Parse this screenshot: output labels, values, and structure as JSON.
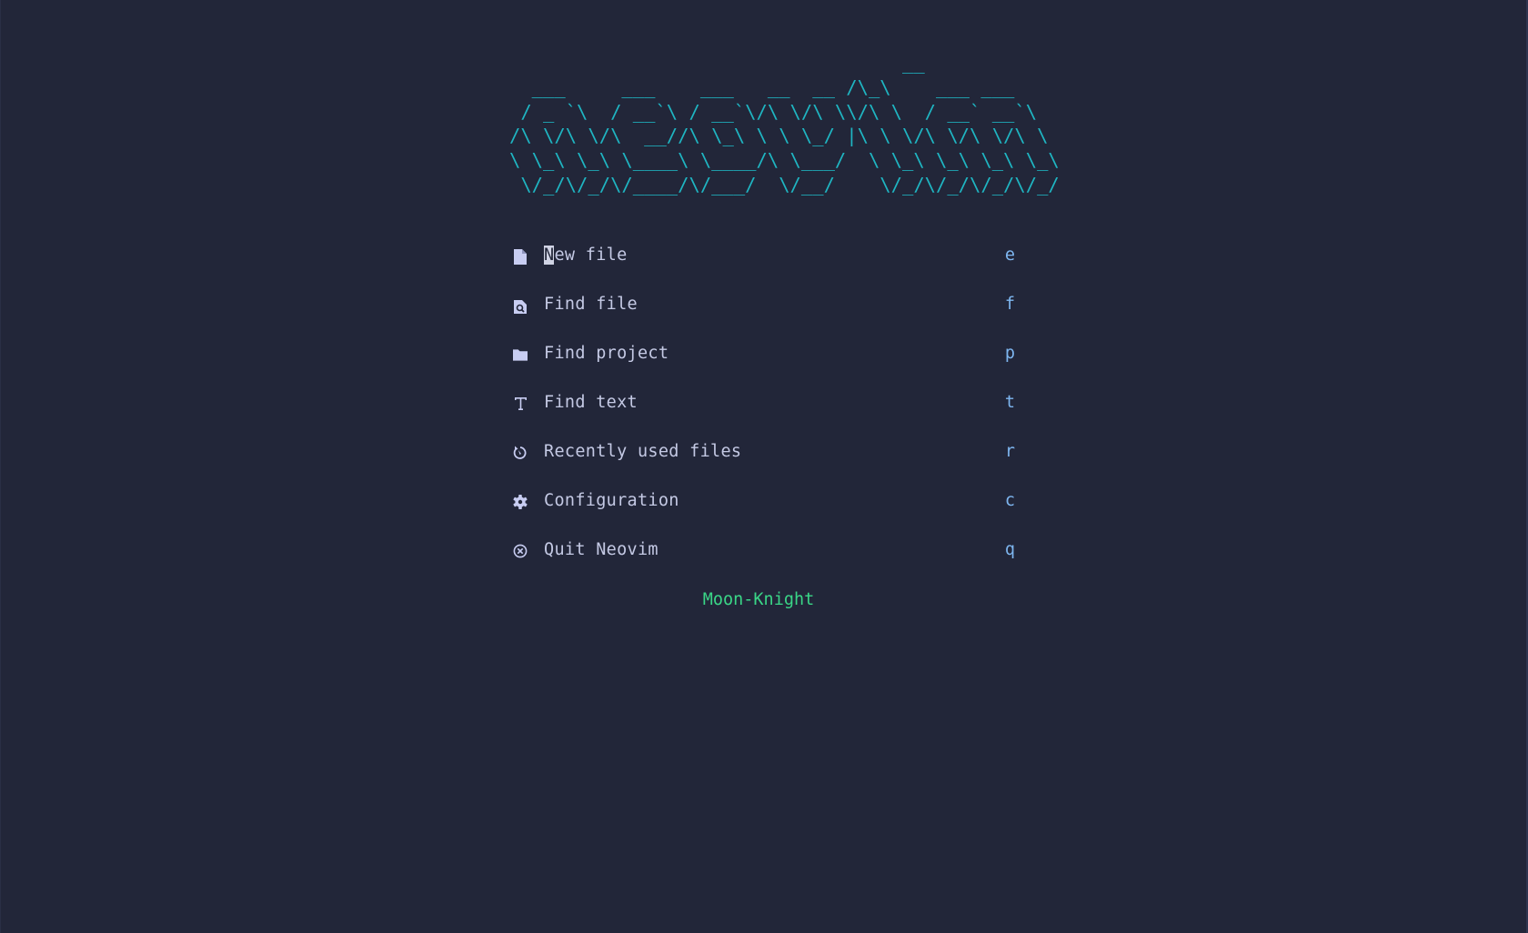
{
  "banner": {
    "ascii_art": "                                   __\n  ___     ___    ___   __  __ /\\_\\    ___ ___\n / _ `\\  / __`\\ / __`\\/\\ \\/\\ \\\\/\\ \\  / __` __`\\\n/\\ \\/\\ \\/\\  __//\\ \\_\\ \\ \\ \\_/ |\\ \\ \\/\\ \\/\\ \\/\\ \\\n\\ \\_\\ \\_\\ \\____\\ \\____/\\ \\___/  \\ \\_\\ \\_\\ \\_\\ \\_\\\n \\/_/\\/_/\\/____/\\/___/  \\/__/    \\/_/\\/_/\\/_/\\/_/",
    "color": "#1fb5c2"
  },
  "menu": {
    "items": [
      {
        "icon": "file-icon",
        "label_first": "N",
        "label_rest": "ew file",
        "key": "e"
      },
      {
        "icon": "file-search-icon",
        "label": "Find file",
        "key": "f"
      },
      {
        "icon": "folder-icon",
        "label": "Find project",
        "key": "p"
      },
      {
        "icon": "text-icon",
        "label": "Find text",
        "key": "t"
      },
      {
        "icon": "history-icon",
        "label": "Recently used files",
        "key": "r"
      },
      {
        "icon": "gear-icon",
        "label": "Configuration",
        "key": "c"
      },
      {
        "icon": "close-circle-icon",
        "label": "Quit Neovim",
        "key": "q"
      }
    ]
  },
  "footer": {
    "text": "Moon-Knight",
    "color": "#3ad687"
  },
  "colors": {
    "background": "#222639",
    "label": "#c4c9e4",
    "key": "#7eb6f0",
    "icon": "#c8cdf2"
  }
}
